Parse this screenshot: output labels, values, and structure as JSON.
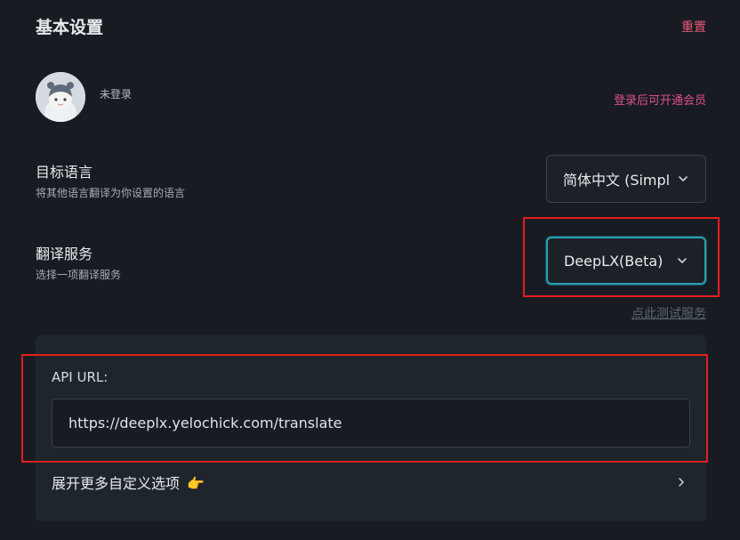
{
  "header": {
    "title": "基本设置",
    "reset_label": "重置"
  },
  "account": {
    "status": "未登录",
    "vip_link": "登录后可开通会员"
  },
  "target_language": {
    "title": "目标语言",
    "description": "将其他语言翻译为你设置的语言",
    "selected": "简体中文 (Simplified Chinese)"
  },
  "translation_service": {
    "title": "翻译服务",
    "description": "选择一项翻译服务",
    "selected": "DeepLX(Beta)",
    "test_link": "点此测试服务"
  },
  "service_config": {
    "api_url_label": "API URL:",
    "api_url_value": "https://deeplx.yelochick.com/translate",
    "more_options_label": "展开更多自定义选项",
    "more_options_emoji": "👉"
  },
  "colors": {
    "background": "#181c22",
    "accent_pink": "#e8577a",
    "focus_teal": "#2aa0b0",
    "highlight_red": "#e41e1e"
  }
}
